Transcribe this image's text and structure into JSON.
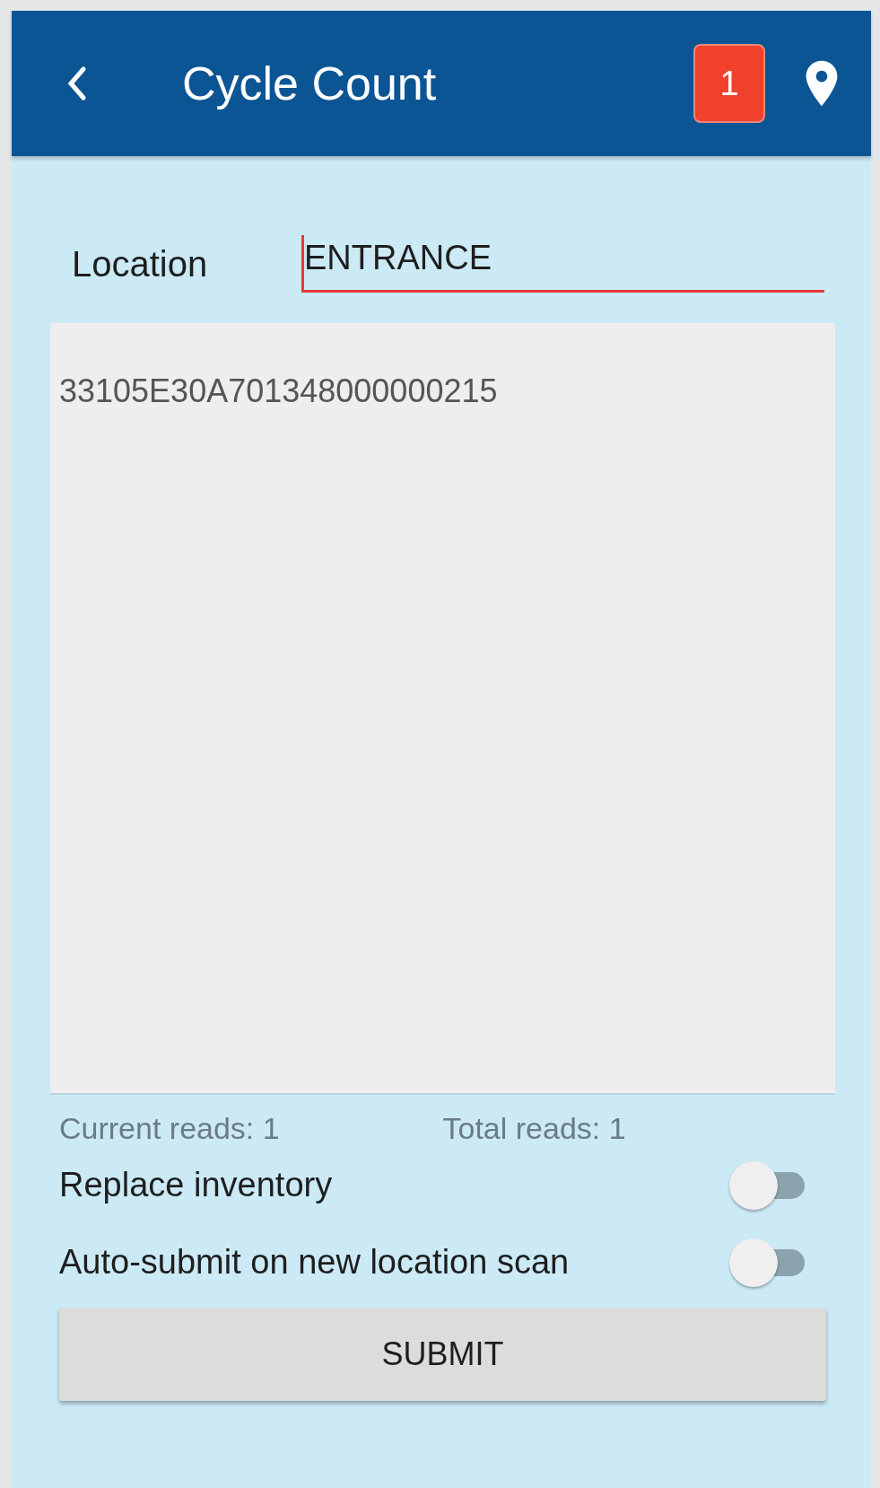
{
  "app_bar": {
    "title": "Cycle Count",
    "badge": "1"
  },
  "location": {
    "label": "Location",
    "value": "ENTRANCE",
    "focused": true
  },
  "tag_list": [
    "33105E30A701348000000215"
  ],
  "counts": {
    "current": "Current reads: 1",
    "total": "Total reads: 1"
  },
  "toggles": [
    {
      "label": "Replace inventory",
      "checked": false
    },
    {
      "label": "Auto-submit on new location scan",
      "checked": false
    }
  ],
  "submit_button": "SUBMIT"
}
